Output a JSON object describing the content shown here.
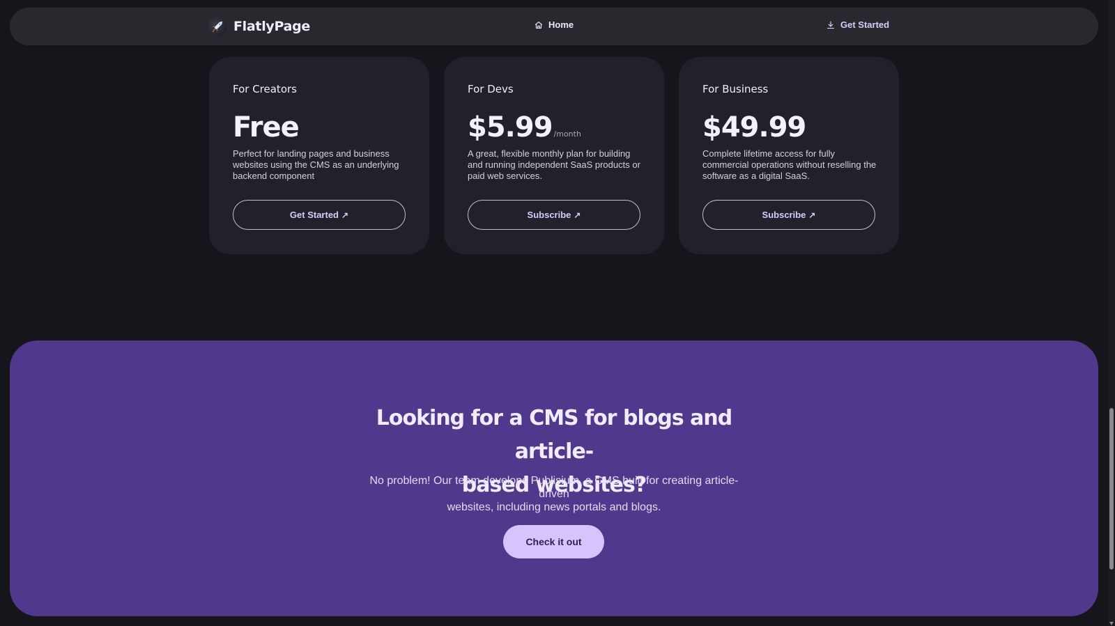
{
  "navbar": {
    "brand": "FlatlyPage",
    "links": [
      {
        "label": "Home",
        "icon": "home-icon"
      },
      {
        "label": "Get Started",
        "icon": "download-icon"
      }
    ]
  },
  "pricing": [
    {
      "tier": "For Creators",
      "price": "Free",
      "period": "",
      "description": "Perfect for landing pages and business websites using the CMS as an underlying backend component",
      "button": "Get Started",
      "button_icon": "arrow-up-right-icon"
    },
    {
      "tier": "For Devs",
      "price": "$5.99",
      "period": "/month",
      "description": "A great, flexible monthly plan for building and running independent SaaS products or paid web services.",
      "button": "Subscribe",
      "button_icon": "arrow-up-right-icon"
    },
    {
      "tier": "For Business",
      "price": "$49.99",
      "period": "",
      "description": "Complete lifetime access for fully commercial operations without reselling the software as a digital SaaS.",
      "button": "Subscribe",
      "button_icon": "arrow-up-right-icon"
    }
  ],
  "cta": {
    "heading_line1": "Looking for a CMS for blogs and article-",
    "heading_line2": "based websites?",
    "text_line1": "No problem! Our team develops Publisium, a CMS built for creating article-driven",
    "text_line2": "websites, including news portals and blogs.",
    "button": "Check it out"
  },
  "colors": {
    "background": "#16151c",
    "navbar": "#29282f",
    "card": "#22212a",
    "cta_background": "#50388c",
    "cta_button": "#d7c4ff",
    "accent_text": "#d7cbff"
  }
}
